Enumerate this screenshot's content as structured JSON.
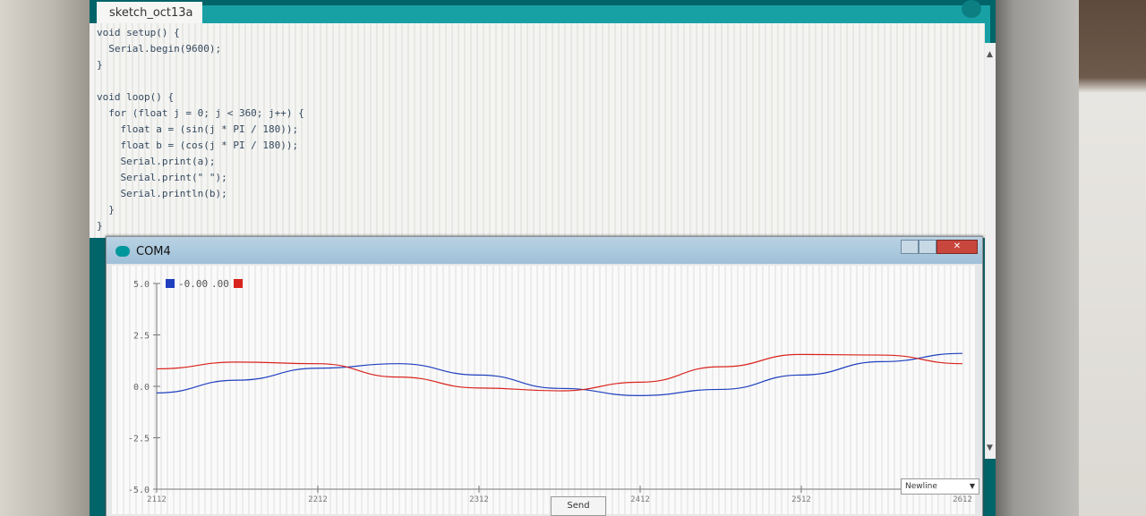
{
  "ide": {
    "tab_label": "sketch_oct13a",
    "code_lines": [
      "void setup() {",
      "  Serial.begin(9600);",
      "}",
      "",
      "void loop() {",
      "  for (float j = 0; j < 360; j++) {",
      "    float a = (sin(j * PI / 180));",
      "    float b = (cos(j * PI / 180));",
      "    Serial.print(a);",
      "    Serial.print(\" \");",
      "    Serial.println(b);",
      "  }",
      "}"
    ],
    "scroll_up_glyph": "▲",
    "scroll_down_glyph": "▼",
    "icons": {
      "search": "search-icon",
      "tab_menu": "chevron-down-icon"
    }
  },
  "plotter": {
    "title": "COM4",
    "close_glyph": "✕",
    "legend": [
      {
        "label": "-0.00",
        "color": "#1f3fbf"
      },
      {
        "label": ".00",
        "color": "#d9231d"
      }
    ],
    "send_label": "Send",
    "line_ending": "Newline",
    "line_ending_caret": "▼"
  },
  "chart_data": {
    "type": "line",
    "ylim": [
      -5.0,
      5.0
    ],
    "y_ticks": [
      "5.0",
      "2.5",
      "0.0",
      "-2.5",
      "-5.0"
    ],
    "x_ticks": [
      "2112",
      "2212",
      "2312",
      "2412",
      "2512",
      "2612"
    ],
    "xlim": [
      2112,
      2612
    ],
    "grid": false,
    "series": [
      {
        "name": "-0.00",
        "color": "#1f3fbf",
        "x": [
          2112,
          2162,
          2212,
          2262,
          2312,
          2362,
          2412,
          2462,
          2512,
          2562,
          2612
        ],
        "values": [
          -0.32,
          0.3,
          0.88,
          1.1,
          0.55,
          -0.1,
          -0.45,
          -0.15,
          0.55,
          1.2,
          1.6
        ]
      },
      {
        "name": ".00",
        "color": "#d9231d",
        "x": [
          2112,
          2162,
          2212,
          2262,
          2312,
          2362,
          2412,
          2462,
          2512,
          2562,
          2612
        ],
        "values": [
          0.85,
          1.18,
          1.1,
          0.45,
          -0.08,
          -0.22,
          0.2,
          0.95,
          1.55,
          1.52,
          1.1
        ]
      }
    ]
  }
}
